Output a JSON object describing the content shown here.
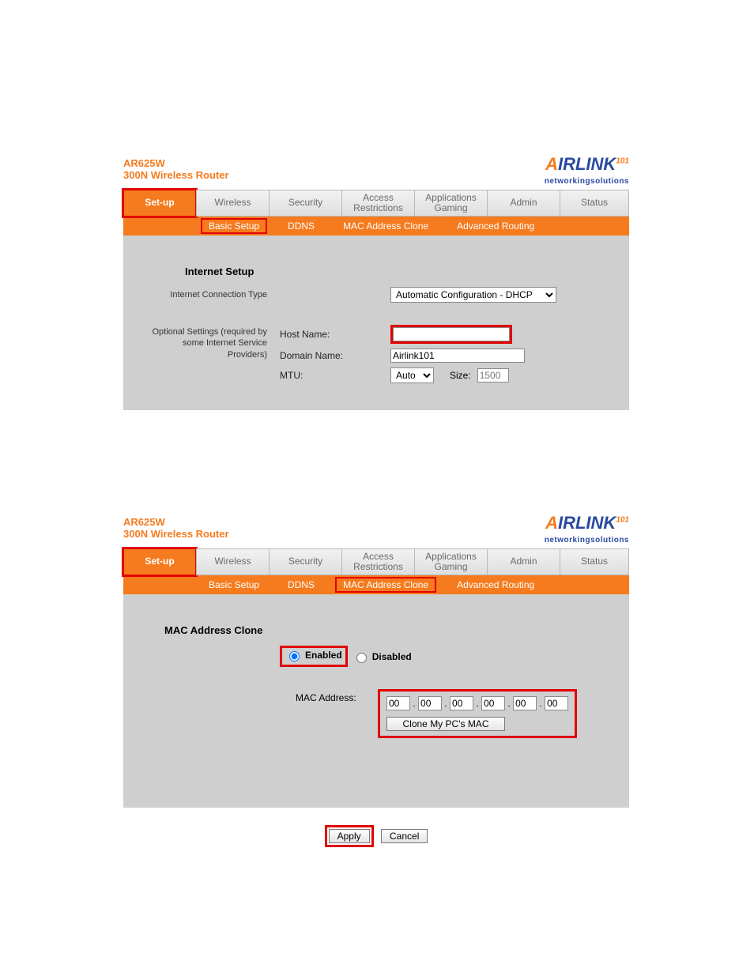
{
  "header": {
    "model": "AR625W",
    "product": "300N Wireless Router",
    "logo_text": "IRLINK",
    "logo_sup": "101",
    "logo_tag": "networkingsolutions"
  },
  "tabs": [
    "Set-up",
    "Wireless",
    "Security",
    "Access\nRestrictions",
    "Applications\nGaming",
    "Admin",
    "Status"
  ],
  "subtabs1": [
    "Basic Setup",
    "DDNS",
    "MAC Address Clone",
    "Advanced Routing"
  ],
  "subtabs2": [
    "Basic Setup",
    "DDNS",
    "MAC Address Clone",
    "Advanced Routing"
  ],
  "panel1": {
    "section_title": "Internet Setup",
    "conn_label": "Internet Connection Type",
    "conn_value": "Automatic Configuration - DHCP",
    "optional_note": "Optional Settings (required by some Internet Service Providers)",
    "host_label": "Host Name:",
    "host_value": "",
    "domain_label": "Domain Name:",
    "domain_value": "Airlink101",
    "mtu_label": "MTU:",
    "mtu_value": "Auto",
    "size_label": "Size:",
    "size_value": "1500"
  },
  "panel2": {
    "section_title": "MAC Address Clone",
    "enabled_label": "Enabled",
    "disabled_label": "Disabled",
    "mac_label": "MAC Address:",
    "mac": [
      "00",
      "00",
      "00",
      "00",
      "00",
      "00"
    ],
    "clone_btn": "Clone My PC's MAC"
  },
  "footer": {
    "apply": "Apply",
    "cancel": "Cancel"
  }
}
